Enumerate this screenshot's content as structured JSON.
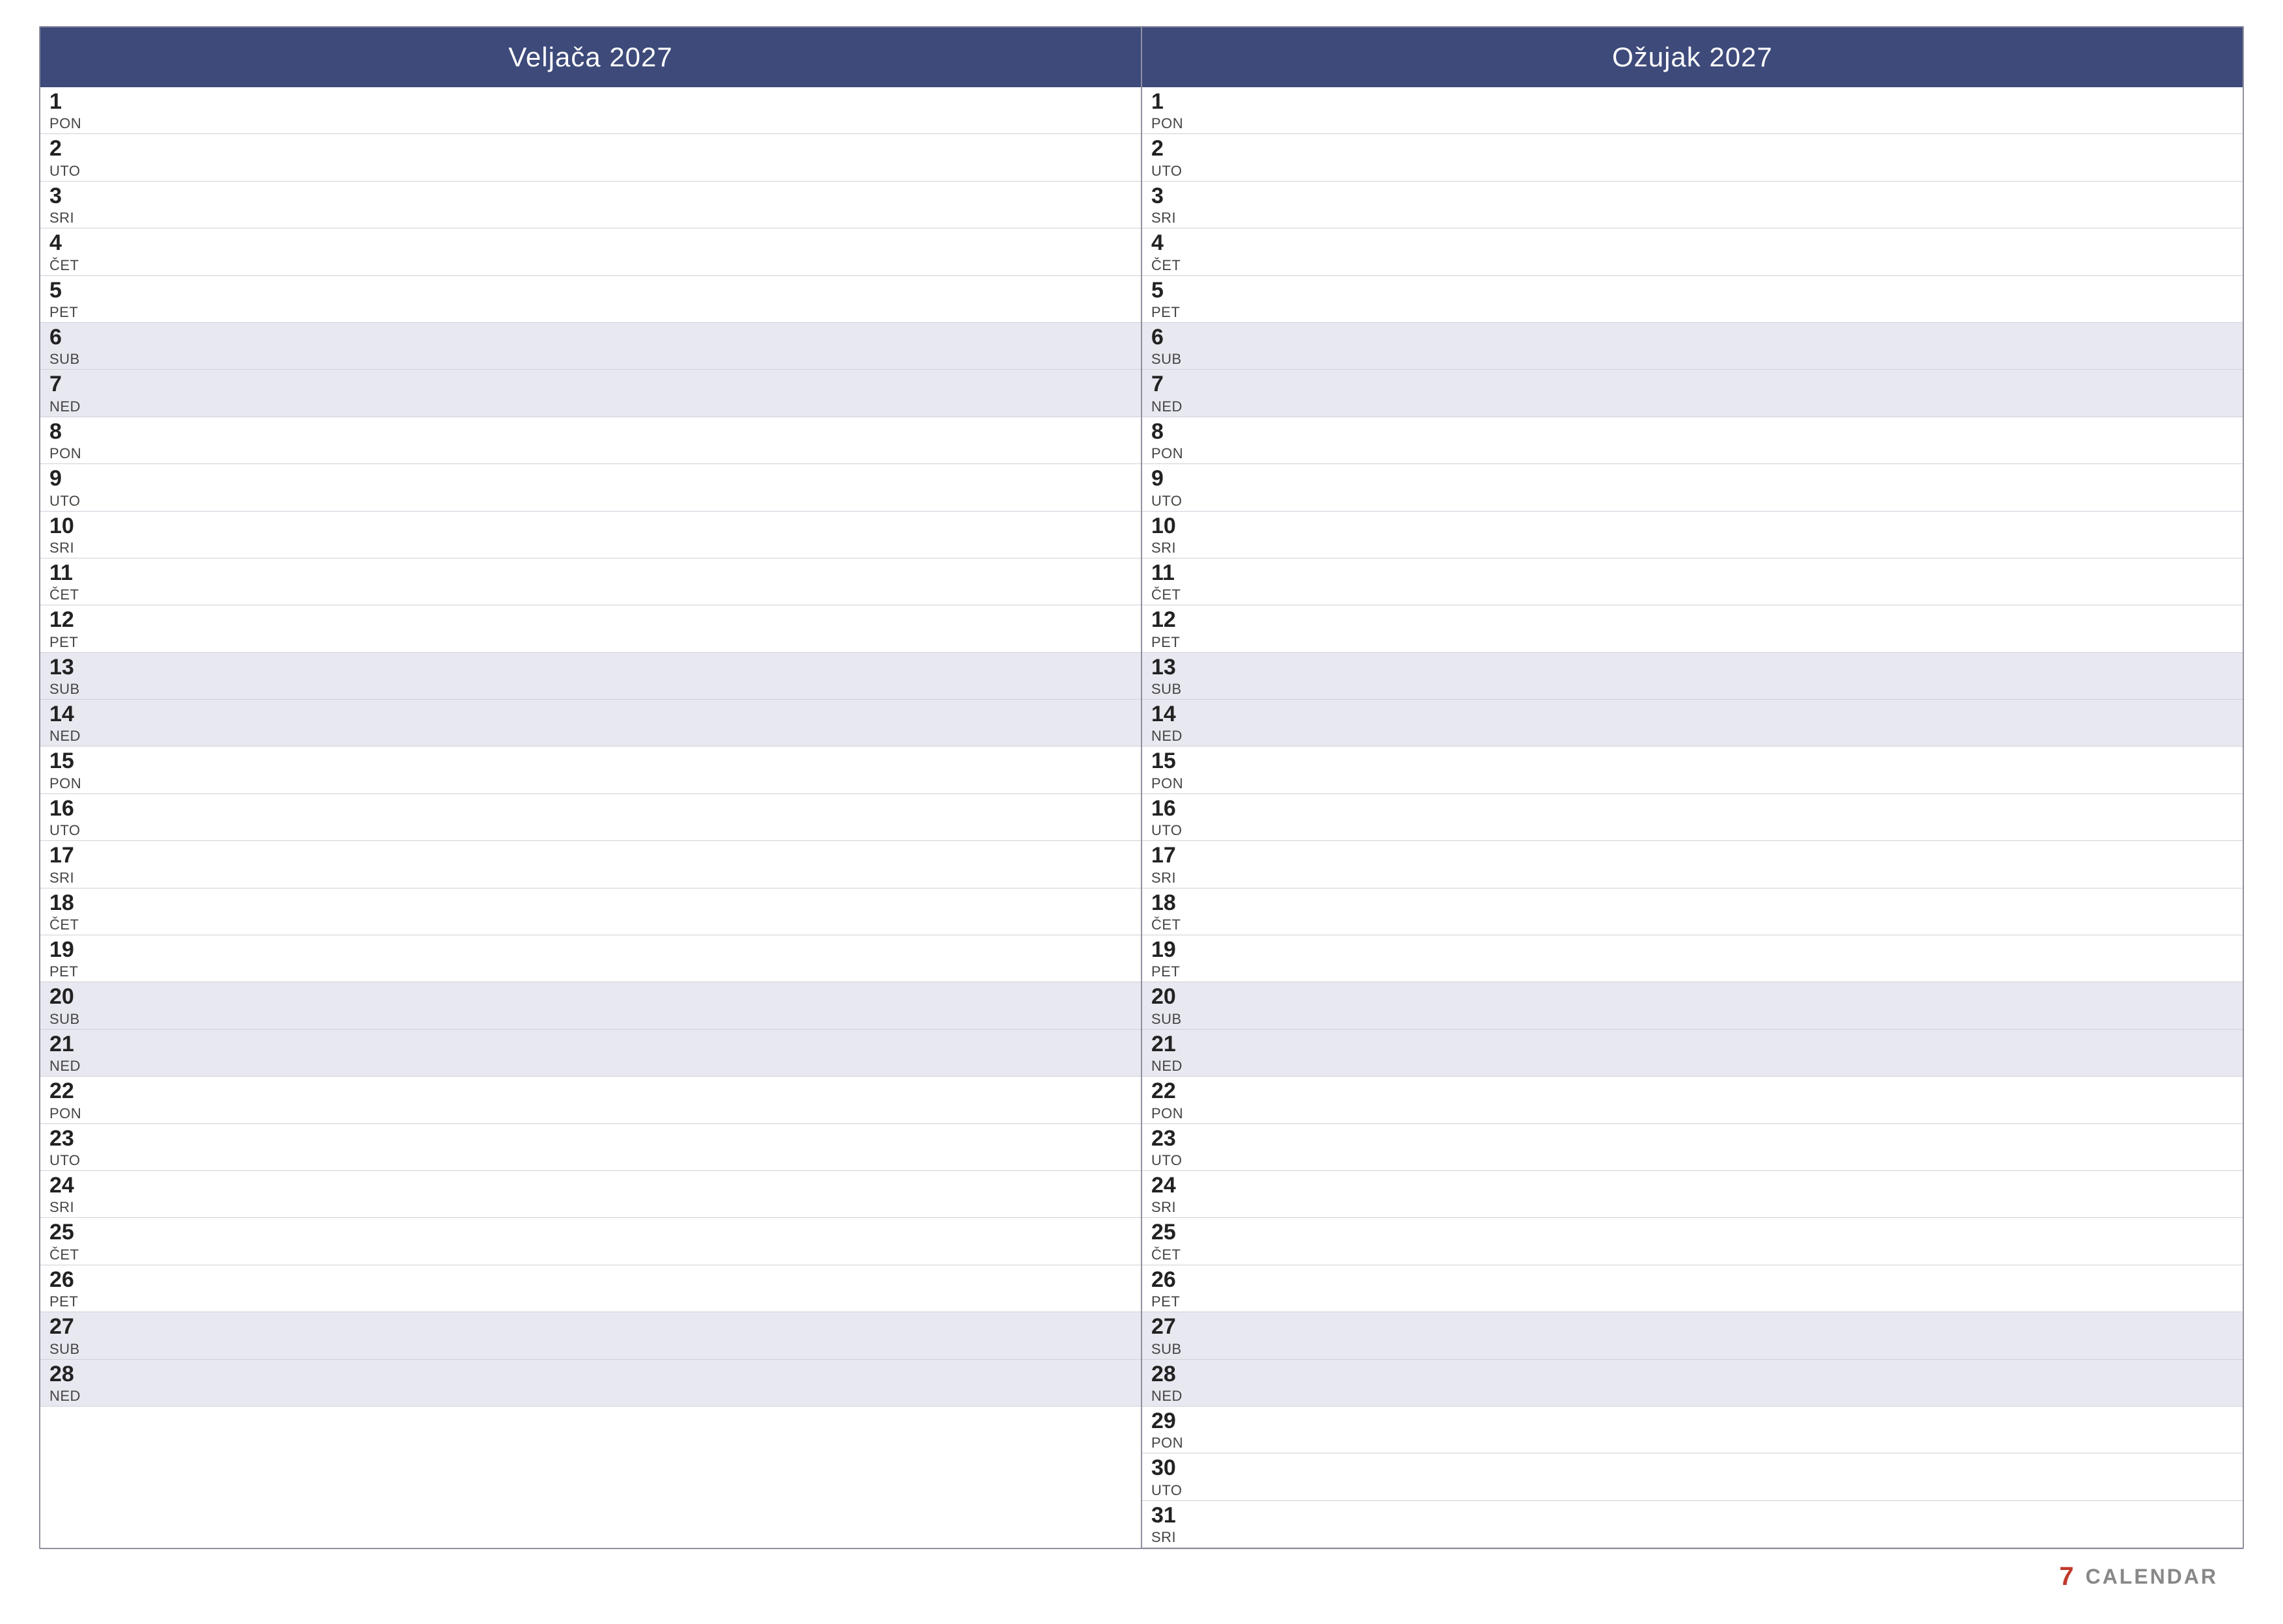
{
  "months": [
    {
      "id": "veljaca",
      "title": "Veljača 2027",
      "days": [
        {
          "num": 1,
          "name": "PON",
          "weekend": false
        },
        {
          "num": 2,
          "name": "UTO",
          "weekend": false
        },
        {
          "num": 3,
          "name": "SRI",
          "weekend": false
        },
        {
          "num": 4,
          "name": "ČET",
          "weekend": false
        },
        {
          "num": 5,
          "name": "PET",
          "weekend": false
        },
        {
          "num": 6,
          "name": "SUB",
          "weekend": true
        },
        {
          "num": 7,
          "name": "NED",
          "weekend": true
        },
        {
          "num": 8,
          "name": "PON",
          "weekend": false
        },
        {
          "num": 9,
          "name": "UTO",
          "weekend": false
        },
        {
          "num": 10,
          "name": "SRI",
          "weekend": false
        },
        {
          "num": 11,
          "name": "ČET",
          "weekend": false
        },
        {
          "num": 12,
          "name": "PET",
          "weekend": false
        },
        {
          "num": 13,
          "name": "SUB",
          "weekend": true
        },
        {
          "num": 14,
          "name": "NED",
          "weekend": true
        },
        {
          "num": 15,
          "name": "PON",
          "weekend": false
        },
        {
          "num": 16,
          "name": "UTO",
          "weekend": false
        },
        {
          "num": 17,
          "name": "SRI",
          "weekend": false
        },
        {
          "num": 18,
          "name": "ČET",
          "weekend": false
        },
        {
          "num": 19,
          "name": "PET",
          "weekend": false
        },
        {
          "num": 20,
          "name": "SUB",
          "weekend": true
        },
        {
          "num": 21,
          "name": "NED",
          "weekend": true
        },
        {
          "num": 22,
          "name": "PON",
          "weekend": false
        },
        {
          "num": 23,
          "name": "UTO",
          "weekend": false
        },
        {
          "num": 24,
          "name": "SRI",
          "weekend": false
        },
        {
          "num": 25,
          "name": "ČET",
          "weekend": false
        },
        {
          "num": 26,
          "name": "PET",
          "weekend": false
        },
        {
          "num": 27,
          "name": "SUB",
          "weekend": true
        },
        {
          "num": 28,
          "name": "NED",
          "weekend": true
        }
      ]
    },
    {
      "id": "ozujak",
      "title": "Ožujak 2027",
      "days": [
        {
          "num": 1,
          "name": "PON",
          "weekend": false
        },
        {
          "num": 2,
          "name": "UTO",
          "weekend": false
        },
        {
          "num": 3,
          "name": "SRI",
          "weekend": false
        },
        {
          "num": 4,
          "name": "ČET",
          "weekend": false
        },
        {
          "num": 5,
          "name": "PET",
          "weekend": false
        },
        {
          "num": 6,
          "name": "SUB",
          "weekend": true
        },
        {
          "num": 7,
          "name": "NED",
          "weekend": true
        },
        {
          "num": 8,
          "name": "PON",
          "weekend": false
        },
        {
          "num": 9,
          "name": "UTO",
          "weekend": false
        },
        {
          "num": 10,
          "name": "SRI",
          "weekend": false
        },
        {
          "num": 11,
          "name": "ČET",
          "weekend": false
        },
        {
          "num": 12,
          "name": "PET",
          "weekend": false
        },
        {
          "num": 13,
          "name": "SUB",
          "weekend": true
        },
        {
          "num": 14,
          "name": "NED",
          "weekend": true
        },
        {
          "num": 15,
          "name": "PON",
          "weekend": false
        },
        {
          "num": 16,
          "name": "UTO",
          "weekend": false
        },
        {
          "num": 17,
          "name": "SRI",
          "weekend": false
        },
        {
          "num": 18,
          "name": "ČET",
          "weekend": false
        },
        {
          "num": 19,
          "name": "PET",
          "weekend": false
        },
        {
          "num": 20,
          "name": "SUB",
          "weekend": true
        },
        {
          "num": 21,
          "name": "NED",
          "weekend": true
        },
        {
          "num": 22,
          "name": "PON",
          "weekend": false
        },
        {
          "num": 23,
          "name": "UTO",
          "weekend": false
        },
        {
          "num": 24,
          "name": "SRI",
          "weekend": false
        },
        {
          "num": 25,
          "name": "ČET",
          "weekend": false
        },
        {
          "num": 26,
          "name": "PET",
          "weekend": false
        },
        {
          "num": 27,
          "name": "SUB",
          "weekend": true
        },
        {
          "num": 28,
          "name": "NED",
          "weekend": true
        },
        {
          "num": 29,
          "name": "PON",
          "weekend": false
        },
        {
          "num": 30,
          "name": "UTO",
          "weekend": false
        },
        {
          "num": 31,
          "name": "SRI",
          "weekend": false
        }
      ]
    }
  ],
  "footer": {
    "icon": "7",
    "brand": "CALENDAR"
  },
  "colors": {
    "header_bg": "#3d4a7a",
    "header_text": "#ffffff",
    "weekend_bg": "#e8e8f0",
    "border": "#9090a0",
    "day_row_border": "#d0d0da",
    "brand_red": "#c0392b",
    "brand_grey": "#888888"
  }
}
